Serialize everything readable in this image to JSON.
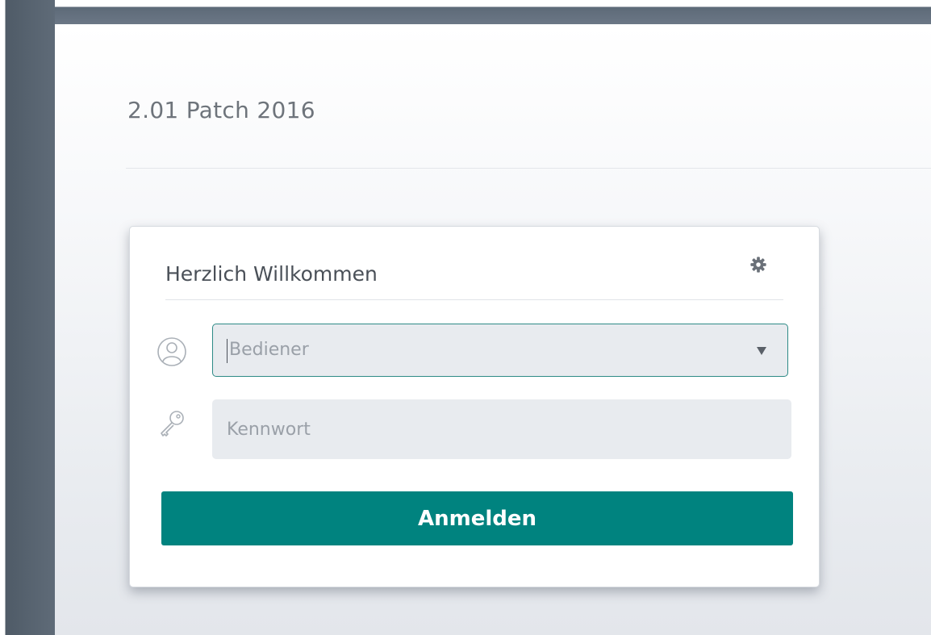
{
  "header": {
    "version_title": "2.01 Patch 2016"
  },
  "login": {
    "title": "Herzlich Willkommen",
    "settings_icon": "gear-icon",
    "user_select": {
      "placeholder": "Bediener",
      "icon": "user-icon"
    },
    "password_field": {
      "placeholder": "Kennwort",
      "value": "",
      "icon": "key-icon"
    },
    "submit_label": "Anmelden"
  },
  "colors": {
    "accent": "#00837f",
    "field_background": "#e8ebef",
    "focus_border": "#2d8a86",
    "sidebar": "#55616d"
  }
}
